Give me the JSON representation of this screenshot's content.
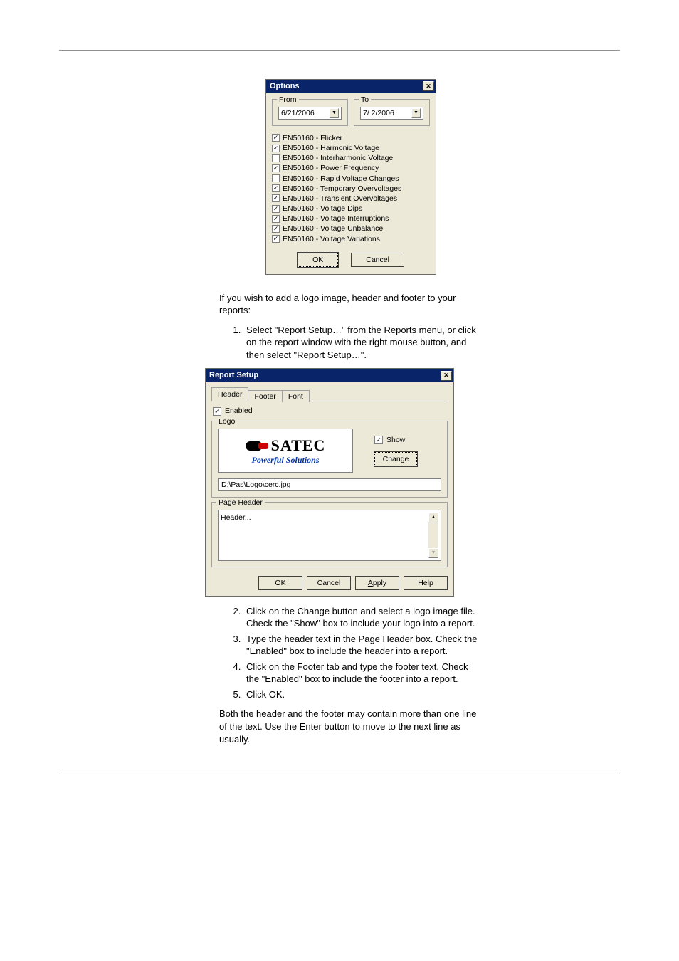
{
  "options_dialog": {
    "title": "Options",
    "from": {
      "legend": "From",
      "value": "6/21/2006"
    },
    "to": {
      "legend": "To",
      "value": "7/ 2/2006"
    },
    "items": [
      {
        "checked": true,
        "label": "EN50160 - Flicker"
      },
      {
        "checked": true,
        "label": "EN50160 - Harmonic Voltage"
      },
      {
        "checked": false,
        "label": "EN50160 - Interharmonic Voltage"
      },
      {
        "checked": true,
        "label": "EN50160 - Power Frequency"
      },
      {
        "checked": false,
        "label": "EN50160 - Rapid Voltage Changes"
      },
      {
        "checked": true,
        "label": "EN50160 - Temporary Overvoltages"
      },
      {
        "checked": true,
        "label": "EN50160 - Transient Overvoltages"
      },
      {
        "checked": true,
        "label": "EN50160 - Voltage Dips"
      },
      {
        "checked": true,
        "label": "EN50160 - Voltage Interruptions"
      },
      {
        "checked": true,
        "label": "EN50160 - Voltage Unbalance"
      },
      {
        "checked": true,
        "label": "EN50160 - Voltage Variations"
      }
    ],
    "ok": "OK",
    "cancel": "Cancel"
  },
  "para_intro": "If you wish to add a logo image, header and footer to your reports:",
  "step1": "Select \"Report Setup…\" from the Reports menu, or click on the report window with the right mouse button, and then select \"Report Setup…\".",
  "report_dialog": {
    "title": "Report Setup",
    "tabs": {
      "header": "Header",
      "footer": "Footer",
      "font": "Font"
    },
    "enabled_label": "Enabled",
    "enabled_checked": true,
    "logo": {
      "legend": "Logo",
      "brand": "SATEC",
      "tagline": "Powerful  Solutions",
      "show_label": "Show",
      "show_checked": true,
      "change_label": "Change",
      "path": "D:\\Pas\\Logo\\cerc.jpg"
    },
    "page_header": {
      "legend": "Page Header",
      "text": "Header..."
    },
    "buttons": {
      "ok": "OK",
      "cancel": "Cancel",
      "apply": "Apply",
      "help": "Help"
    }
  },
  "step2": "Click on the Change button and select a logo image file. Check the \"Show\" box to include your logo into a report.",
  "step3": "Type the header text in the Page Header box. Check the \"Enabled\" box to include the header into a report.",
  "step4": "Click on the Footer tab and type the footer text. Check the \"Enabled\" box to include the footer into a report.",
  "step5": "Click OK.",
  "para_out": "Both the header and the footer may contain more than one line of the text. Use the Enter button to move to the next line as usually."
}
